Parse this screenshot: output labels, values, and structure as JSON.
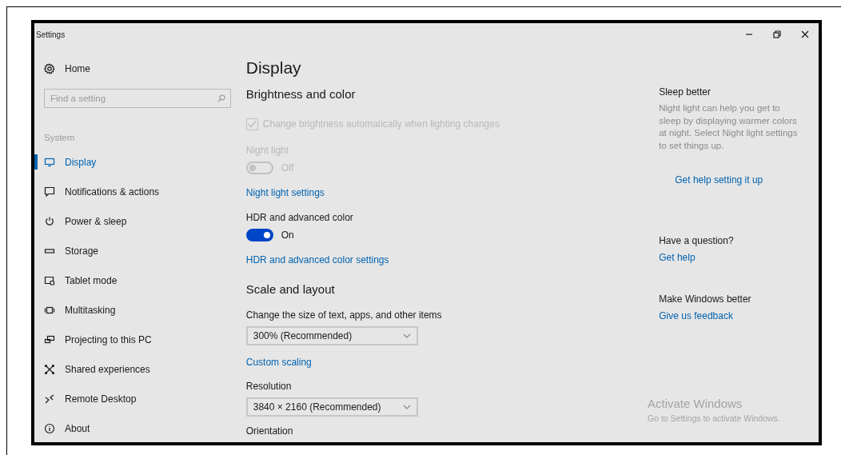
{
  "window": {
    "title": "Settings"
  },
  "sidebar": {
    "home": "Home",
    "search": {
      "placeholder": "Find a setting"
    },
    "section": "System",
    "items": [
      {
        "label": "Display",
        "selected": true
      },
      {
        "label": "Notifications & actions",
        "selected": false
      },
      {
        "label": "Power & sleep",
        "selected": false
      },
      {
        "label": "Storage",
        "selected": false
      },
      {
        "label": "Tablet mode",
        "selected": false
      },
      {
        "label": "Multitasking",
        "selected": false
      },
      {
        "label": "Projecting to this PC",
        "selected": false
      },
      {
        "label": "Shared experiences",
        "selected": false
      },
      {
        "label": "Remote Desktop",
        "selected": false
      },
      {
        "label": "About",
        "selected": false
      }
    ]
  },
  "main": {
    "title": "Display",
    "sections": [
      {
        "heading": "Brightness and color",
        "controls": [
          {
            "kind": "checkbox",
            "label": "Change brightness automatically when lighting changes",
            "checked": true,
            "disabled": true
          },
          {
            "kind": "toggle",
            "label": "Night light",
            "on": false,
            "state_text": "Off",
            "disabled": true
          },
          {
            "kind": "link",
            "text": "Night light settings"
          },
          {
            "kind": "toggle",
            "label": "HDR and advanced color",
            "on": true,
            "state_text": "On",
            "disabled": false
          },
          {
            "kind": "link",
            "text": "HDR and advanced color settings"
          }
        ]
      },
      {
        "heading": "Scale and layout",
        "controls": [
          {
            "kind": "dropdown",
            "label": "Change the size of text, apps, and other items",
            "value": "300% (Recommended)"
          },
          {
            "kind": "link",
            "text": "Custom scaling"
          },
          {
            "kind": "dropdown",
            "label": "Resolution",
            "value": "3840 × 2160 (Recommended)"
          },
          {
            "kind": "label",
            "text": "Orientation"
          }
        ]
      }
    ]
  },
  "aside": {
    "blocks": [
      {
        "heading": "Sleep better",
        "text": "Night light can help you get to sleep by displaying warmer colors at night. Select Night light settings to set things up.",
        "link": "Get help setting it up"
      },
      {
        "heading": "Have a question?",
        "link": "Get help"
      },
      {
        "heading": "Make Windows better",
        "link": "Give us feedback"
      }
    ]
  },
  "activation": {
    "title": "Activate Windows",
    "text": "Go to Settings to activate Windows."
  }
}
